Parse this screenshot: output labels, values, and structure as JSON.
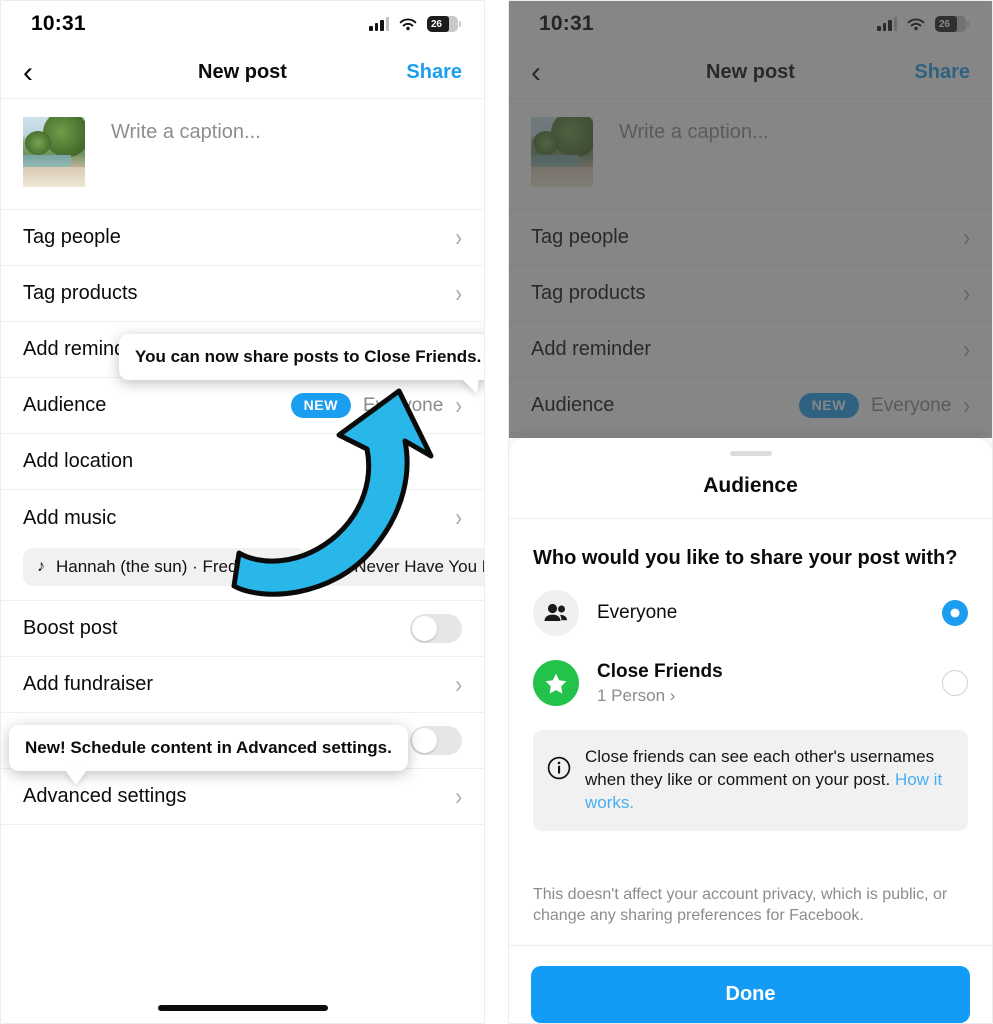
{
  "status_bar": {
    "time": "10:31",
    "battery_level": "26",
    "icons": [
      "signal-bars-icon",
      "wifi-icon",
      "battery-icon"
    ]
  },
  "nav": {
    "back_icon": "chevron-left-icon",
    "title": "New post",
    "share_label": "Share"
  },
  "composer": {
    "caption_placeholder": "Write a caption...",
    "thumbnail_name": "post-thumbnail"
  },
  "rows": [
    {
      "label": "Tag people",
      "type": "chevron"
    },
    {
      "label": "Tag products",
      "type": "chevron"
    },
    {
      "label": "Add reminder",
      "type": "chevron"
    },
    {
      "label": "Audience",
      "type": "value",
      "badge": "NEW",
      "value": "Everyone"
    },
    {
      "label": "Add location",
      "type": "plain"
    },
    {
      "label": "Add music",
      "type": "chevron"
    },
    {
      "label": "Boost post",
      "type": "toggle",
      "toggle_state": "off"
    },
    {
      "label": "Add fundraiser",
      "type": "chevron"
    },
    {
      "label": "Advanced settings",
      "type": "chevron"
    }
  ],
  "music_chips": [
    {
      "label": "Hannah (the sun) · Fred again..",
      "icon": "music-note-icon"
    },
    {
      "label": "Never Have You L",
      "icon": "music-note-icon"
    }
  ],
  "hidden_toggle_row": {
    "toggle_state": "off"
  },
  "tooltips": {
    "audience": "You can now share posts to Close Friends.",
    "schedule": "New! Schedule content in Advanced settings."
  },
  "annotation": {
    "arrow_color": "#29b6e8",
    "arrow_outline": "#0a0a0a",
    "arrow_name": "curved-arrow-annotation"
  },
  "sheet": {
    "title": "Audience",
    "question": "Who would you like to share your post with?",
    "options": [
      {
        "name": "Everyone",
        "icon": "people-icon",
        "selected": "true",
        "subtitle": ""
      },
      {
        "name": "Close Friends",
        "icon": "star-icon",
        "selected": "false",
        "subtitle": "1 Person ›"
      }
    ],
    "info": {
      "icon": "info-icon",
      "text": "Close friends can see each other's usernames when they like or comment on your post. ",
      "link": "How it works."
    },
    "footnote": "This doesn't affect your account privacy, which is public, or change any sharing preferences for Facebook.",
    "done_label": "Done"
  },
  "colors": {
    "accent_blue": "#1b9df0",
    "done_blue": "#129cf5",
    "close_friends_green": "#23c24a",
    "link_blue": "#4aaef2"
  }
}
